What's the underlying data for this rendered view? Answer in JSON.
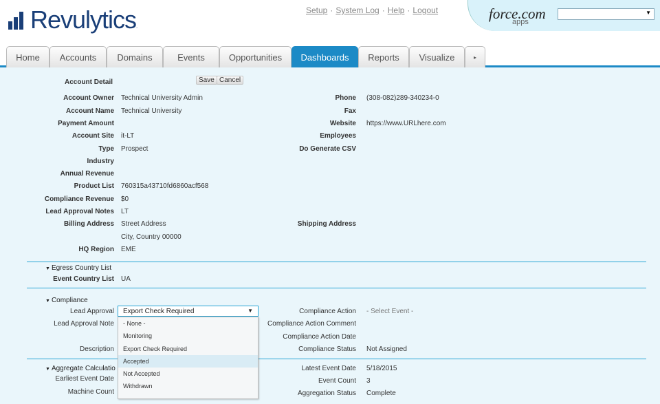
{
  "brand": {
    "name": "Revulytics",
    "tm": "."
  },
  "toplinks": [
    {
      "label": "Setup"
    },
    {
      "label": "System Log"
    },
    {
      "label": "Help"
    },
    {
      "label": "Logout"
    }
  ],
  "link_separator": "·",
  "force": {
    "logo": "force.com",
    "apps": "apps",
    "app_select_value": ""
  },
  "tabs": [
    "Home",
    "Accounts",
    "Domains",
    "Events",
    "Opportunities",
    "Dashboards",
    "Reports",
    "Visualize"
  ],
  "active_tab": "Dashboards",
  "tab_more_icon": "▸",
  "detail": {
    "heading": "Account Detail",
    "save_label": "Save",
    "cancel_label": "Cancel",
    "left": [
      {
        "label": "Account Owner",
        "value": "Technical University Admin"
      },
      {
        "label": "Account Name",
        "value": "Technical University"
      },
      {
        "label": "Payment Amount",
        "value": ""
      },
      {
        "label": "Account Site",
        "value": "it-LT"
      },
      {
        "label": "Type",
        "value": "Prospect"
      },
      {
        "label": "Industry",
        "value": ""
      },
      {
        "label": "Annual Revenue",
        "value": ""
      },
      {
        "label": "Product List",
        "value": "760315a43710fd6860acf568"
      },
      {
        "label": "Compliance Revenue",
        "value": "$0"
      },
      {
        "label": "Lead Approval Notes",
        "value": "LT"
      },
      {
        "label": "Billing Address",
        "value": "Street Address"
      },
      {
        "label": "",
        "value": "City, Country 00000"
      },
      {
        "label": "HQ Region",
        "value": "EME"
      }
    ],
    "right": [
      {
        "label": "Phone",
        "value": "(308-082)289-340234-0"
      },
      {
        "label": "Fax",
        "value": ""
      },
      {
        "label": "Website",
        "value": "https://www.URLhere.com"
      },
      {
        "label": "Employees",
        "value": ""
      },
      {
        "label": "Do Generate CSV",
        "value": ""
      },
      {
        "label": "Shipping Address",
        "value": ""
      }
    ]
  },
  "egress": {
    "title": "Egress Country List",
    "field_label": "Event Country List",
    "field_value": "UA"
  },
  "compliance": {
    "title": "Compliance",
    "lead_approval_label": "Lead Approval",
    "lead_approval_value": "Export Check Required",
    "lead_approval_note_label": "Lead Approval Note",
    "description_label": "Description",
    "options": [
      "- None -",
      "Monitoring",
      "Export Check Required",
      "Accepted",
      "Not Accepted",
      "Withdrawn"
    ],
    "highlighted_option": "Accepted",
    "right": [
      {
        "label": "Compliance Action",
        "value": "- Select Event -"
      },
      {
        "label": "Compliance Action Comment",
        "value": ""
      },
      {
        "label": "Compliance Action Date",
        "value": ""
      },
      {
        "label": "Compliance Status",
        "value": "Not Assigned"
      }
    ]
  },
  "aggregate": {
    "title": "Aggregate Calculatio",
    "left": [
      {
        "label": "Earliest Event Date",
        "value": ""
      },
      {
        "label": "Machine Count",
        "value": ""
      }
    ],
    "right": [
      {
        "label": "Latest Event Date",
        "value": "5/18/2015"
      },
      {
        "label": "Event Count",
        "value": "3"
      },
      {
        "label": "Aggregation Status",
        "value": "Complete"
      }
    ]
  },
  "icons": {
    "collapse": "collapse-triangle-icon",
    "dropdown": "chevron-down-icon"
  }
}
